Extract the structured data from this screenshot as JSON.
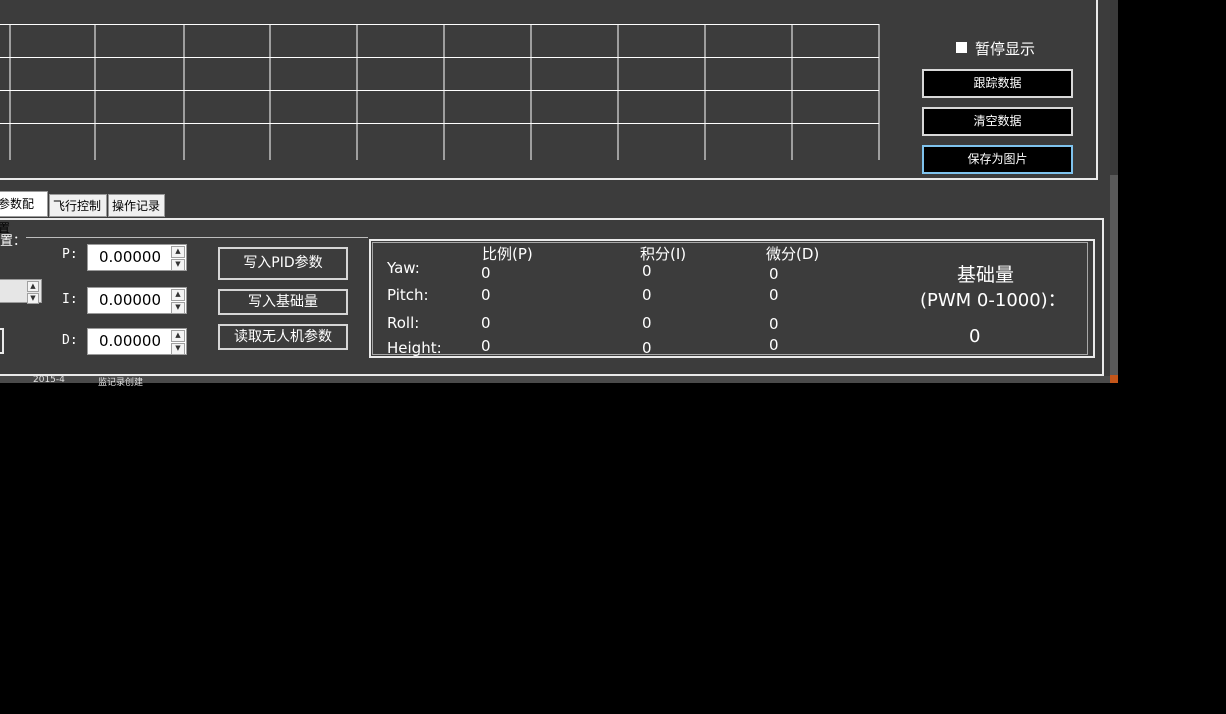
{
  "controls": {
    "pause_display": "暂停显示",
    "track_data": "跟踪数据",
    "clear_data": "清空数据",
    "save_image": "保存为图片"
  },
  "tabs": [
    "参数配置",
    "飞行控制",
    "操作记录"
  ],
  "config": {
    "group_label": "置：",
    "p_label": "P:",
    "i_label": "I:",
    "d_label": "D:",
    "p_value": "0.00000",
    "i_value": "0.00000",
    "d_value": "0.00000",
    "write_pid": "写入PID参数",
    "write_base": "写入基础量",
    "read_params": "读取无人机参数"
  },
  "pid_table": {
    "headers": [
      "比例(P)",
      "积分(I)",
      "微分(D)"
    ],
    "rows": [
      {
        "name": "Yaw:",
        "p": "0",
        "i": "0",
        "d": "0"
      },
      {
        "name": "Pitch:",
        "p": "0",
        "i": "0",
        "d": "0"
      },
      {
        "name": "Roll:",
        "p": "0",
        "i": "0",
        "d": "0"
      },
      {
        "name": "Height:",
        "p": "0",
        "i": "0",
        "d": "0"
      }
    ]
  },
  "base": {
    "title": "基础量",
    "subtitle": "(PWM 0-1000)：",
    "value": "0"
  },
  "taskbar": {
    "item1": "2015-4",
    "item2": "监记录创建"
  },
  "colors": {
    "background": "#3c3c3c",
    "grid": "#ffffff",
    "focus_border": "#7fc3ee"
  }
}
